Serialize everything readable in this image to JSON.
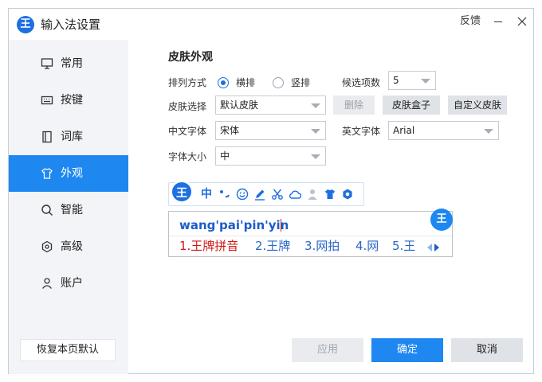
{
  "window": {
    "title": "输入法设置",
    "logo_glyph": "王",
    "feedback_label": "反馈",
    "minimize_icon": "minimize-icon",
    "close_icon": "close-icon"
  },
  "sidebar": {
    "items": [
      {
        "label": "常用",
        "icon": "monitor-icon"
      },
      {
        "label": "按键",
        "icon": "keyboard-icon"
      },
      {
        "label": "词库",
        "icon": "book-icon"
      },
      {
        "label": "外观",
        "icon": "shirt-icon",
        "active": true
      },
      {
        "label": "智能",
        "icon": "search-icon"
      },
      {
        "label": "高级",
        "icon": "hexagon-icon"
      },
      {
        "label": "账户",
        "icon": "user-icon"
      }
    ],
    "restore_label": "恢复本页默认"
  },
  "skin": {
    "section_title": "皮肤外观",
    "layout_label": "排列方式",
    "layout_options": [
      "横排",
      "竖排"
    ],
    "layout_selected": "横排",
    "candidate_count_label": "候选项数",
    "candidate_count_value": "5",
    "skin_select_label": "皮肤选择",
    "skin_select_value": "默认皮肤",
    "delete_label": "删除",
    "skin_box_label": "皮肤盒子",
    "custom_skin_label": "自定义皮肤",
    "cn_font_label": "中文字体",
    "cn_font_value": "宋体",
    "en_font_label": "英文字体",
    "en_font_value": "Arial",
    "font_size_label": "字体大小",
    "font_size_value": "中"
  },
  "preview": {
    "toolbar_logo": "王",
    "toolbar_mode": "中",
    "toolbar_icons": [
      "punctuation-icon",
      "smiley-icon",
      "pencil-icon",
      "scissors-icon",
      "cloud-icon",
      "user-icon",
      "shirt-icon",
      "gear-icon"
    ],
    "pinyin": "wang'pai'pin'yin",
    "candidates": [
      "1.王牌拼音",
      "2.王牌",
      "3.网拍",
      "4.网",
      "5.王"
    ],
    "candidate_logo": "王"
  },
  "footer": {
    "apply_label": "应用",
    "ok_label": "确定",
    "cancel_label": "取消"
  },
  "colors": {
    "accent": "#1e88f0",
    "brand": "#1e6fe0",
    "first_candidate": "#d01818",
    "candidate": "#2a66c8"
  }
}
